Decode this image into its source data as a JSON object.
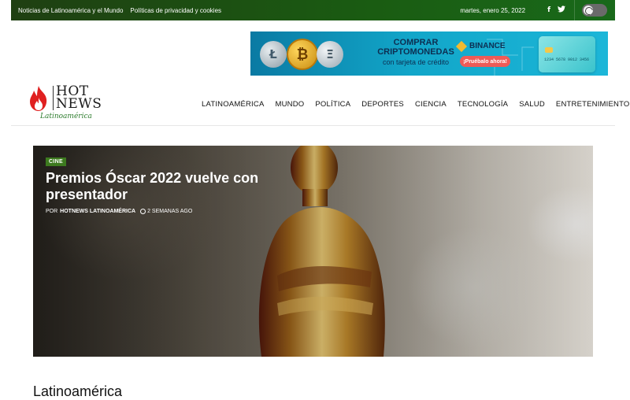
{
  "topbar": {
    "links": [
      "Noticias de Latinoamérica y el Mundo",
      "Políticas de privacidad y cookies"
    ],
    "date": "martes, enero 25, 2022",
    "social": [
      {
        "icon": "facebook-icon",
        "glyph": "f"
      },
      {
        "icon": "twitter-icon",
        "glyph": "🐦"
      }
    ],
    "dark_mode_toggle": {
      "icon": "moon-icon",
      "enabled": false
    }
  },
  "ad": {
    "title": "COMPRAR CRIPTOMONEDAS",
    "subtitle": "con tarjeta de crédito",
    "brand": "BINANCE",
    "cta": "¡Pruébalo ahora!",
    "coins": [
      "Ł",
      "₿",
      "Ξ"
    ],
    "card_number": "1234 5678 9012 3456"
  },
  "logo": {
    "line1": "HOT",
    "line2": "NEWS",
    "tagline": "Latinoamérica"
  },
  "nav": {
    "items": [
      "LATINOAMÉRICA",
      "MUNDO",
      "POLÍTICA",
      "DEPORTES",
      "CIENCIA",
      "TECNOLOGÍA",
      "SALUD",
      "ENTRETENIMIENTO"
    ]
  },
  "hero": {
    "category": "CINE",
    "title": "Premios Óscar 2022 vuelve con presentador",
    "by_prefix": "POR",
    "author": "HOTNEWS LATINOAMÉRICA",
    "time": "2 SEMANAS AGO"
  },
  "section": {
    "heading": "Latinoamérica"
  },
  "colors": {
    "topbar": "#1a5c12",
    "accent_green": "#3d7a1f",
    "flame": "#e02020"
  }
}
